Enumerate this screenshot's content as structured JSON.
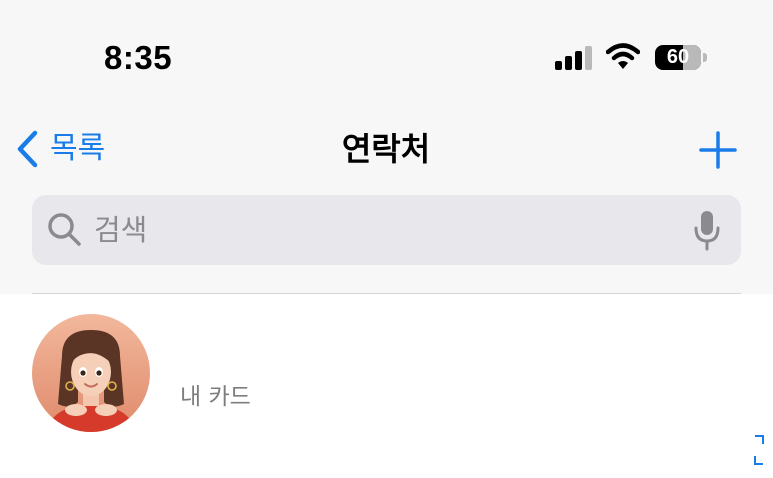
{
  "status_bar": {
    "time": "8:35",
    "battery": "60",
    "icons": [
      "cellular-signal-icon",
      "wifi-icon",
      "battery-icon"
    ]
  },
  "nav": {
    "back_label": "목록",
    "title": "연락처",
    "icons": [
      "chevron-left-icon",
      "plus-icon"
    ]
  },
  "search": {
    "placeholder": "검색",
    "icons": [
      "search-icon",
      "microphone-icon"
    ]
  },
  "my_card": {
    "name": "",
    "subtitle": "내 카드",
    "avatar": "memoji-avatar"
  },
  "colors": {
    "accent": "#1a7ce8",
    "header_background": "#f7f7f7",
    "search_background": "#e8e8ec",
    "secondary_text": "#7d7d80"
  }
}
